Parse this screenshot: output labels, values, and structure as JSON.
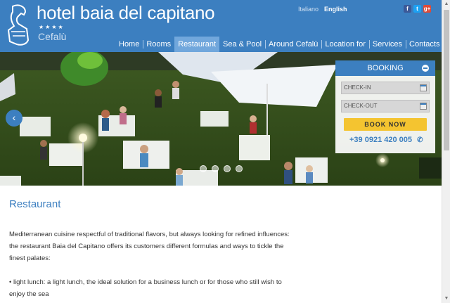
{
  "brand": {
    "name": "hotel baia del capitano",
    "stars": "★★★★",
    "city": "Cefalù"
  },
  "languages": {
    "italian": "Italiano",
    "english": "English"
  },
  "social": {
    "facebook": "f",
    "twitter": "t",
    "googleplus": "g+"
  },
  "nav": {
    "items": [
      {
        "label": "Home"
      },
      {
        "label": "Rooms"
      },
      {
        "label": "Restaurant",
        "active": true
      },
      {
        "label": "Sea & Pool"
      },
      {
        "label": "Around Cefalù"
      },
      {
        "label": "Location for"
      },
      {
        "label": "Services"
      },
      {
        "label": "Contacts"
      }
    ]
  },
  "slider": {
    "prev_icon": "‹",
    "slide_count": 4
  },
  "booking": {
    "title": "BOOKING",
    "checkin_placeholder": "CHECK-IN",
    "checkout_placeholder": "CHECK-OUT",
    "book_now": "BOOK NOW",
    "phone": "+39 0921 420 005",
    "phone_icon": "✆"
  },
  "content": {
    "heading": "Restaurant",
    "paragraph1": "Mediterranean cuisine respectful of traditional flavors, but always looking for refined influences: the restaurant Baia del Capitano offers its customers different formulas and ways to tickle the finest palates:",
    "paragraph2": "• light lunch: a light lunch, the ideal solution for a business lunch or for those who still wish to enjoy the sea"
  },
  "colors": {
    "brand_blue": "#3c7fc0",
    "accent_yellow": "#f4c430"
  }
}
